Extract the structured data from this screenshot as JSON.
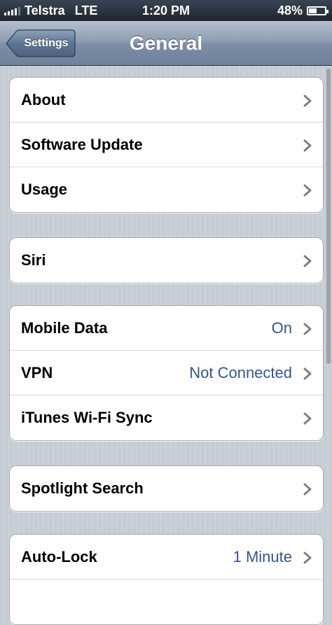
{
  "status_bar": {
    "carrier": "Telstra",
    "network": "LTE",
    "time": "1:20 PM",
    "battery_percent": "48%",
    "battery_level": 0.48
  },
  "nav": {
    "back_label": "Settings",
    "title": "General"
  },
  "groups": [
    [
      {
        "label": "About",
        "value": ""
      },
      {
        "label": "Software Update",
        "value": ""
      },
      {
        "label": "Usage",
        "value": ""
      }
    ],
    [
      {
        "label": "Siri",
        "value": ""
      }
    ],
    [
      {
        "label": "Mobile Data",
        "value": "On"
      },
      {
        "label": "VPN",
        "value": "Not Connected"
      },
      {
        "label": "iTunes Wi-Fi Sync",
        "value": ""
      }
    ],
    [
      {
        "label": "Spotlight Search",
        "value": ""
      }
    ],
    [
      {
        "label": "Auto-Lock",
        "value": "1 Minute"
      },
      {
        "label": "",
        "value": ""
      }
    ]
  ],
  "icons": {
    "row_chevron": "chevron-right-icon",
    "back": "back-arrow-button"
  },
  "colors": {
    "value_text": "#385487",
    "nav_bar": "#7d8ea5",
    "background": "#c5ccd4"
  }
}
